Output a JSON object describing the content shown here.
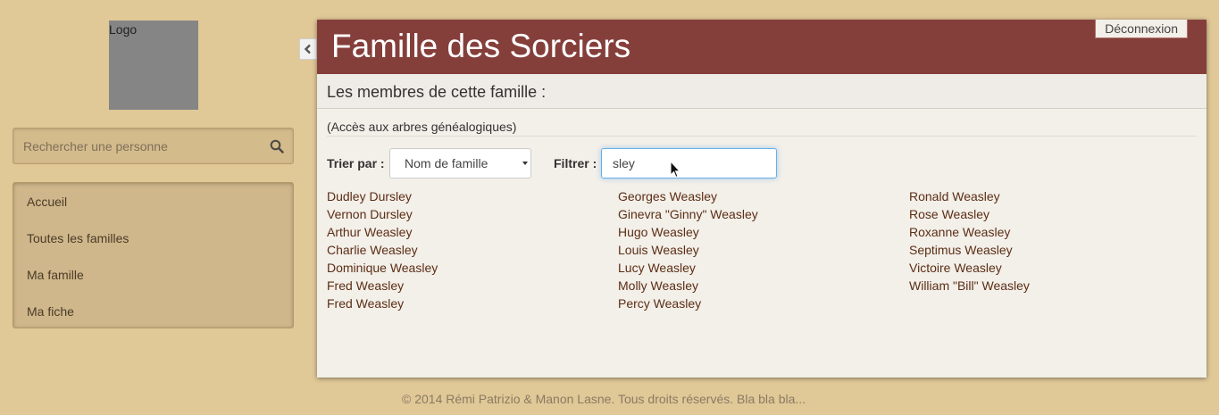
{
  "logo": {
    "label": "Logo"
  },
  "search": {
    "placeholder": "Rechercher une personne",
    "icon": "search-icon"
  },
  "nav": {
    "items": [
      {
        "label": "Accueil"
      },
      {
        "label": "Toutes les familles"
      },
      {
        "label": "Ma famille"
      },
      {
        "label": "Ma fiche"
      }
    ]
  },
  "header": {
    "title": "Famille des Sorciers",
    "logout_label": "Déconnexion"
  },
  "content": {
    "subtitle": "Les membres de cette famille :",
    "access_label": "(Accès aux arbres généalogiques)",
    "sort_label": "Trier par :",
    "sort_value": "Nom de famille",
    "filter_label": "Filtrer :",
    "filter_value": "sley"
  },
  "members": {
    "columns": [
      [
        "Dudley Dursley",
        "Vernon Dursley",
        "Arthur Weasley",
        "Charlie Weasley",
        "Dominique Weasley",
        "Fred Weasley",
        "Fred Weasley"
      ],
      [
        "Georges Weasley",
        "Ginevra \"Ginny\" Weasley",
        "Hugo Weasley",
        "Louis Weasley",
        "Lucy Weasley",
        "Molly Weasley",
        "Percy Weasley"
      ],
      [
        "Ronald Weasley",
        "Rose Weasley",
        "Roxanne Weasley",
        "Septimus Weasley",
        "Victoire Weasley",
        "William \"Bill\" Weasley"
      ]
    ]
  },
  "footer": {
    "text": "© 2014 Rémi Patrizio & Manon Lasne. Tous droits réservés. Bla bla bla..."
  },
  "colors": {
    "background": "#e0c897",
    "header": "#853f3b",
    "link": "#5b2e15",
    "panel": "#f3efe9"
  }
}
